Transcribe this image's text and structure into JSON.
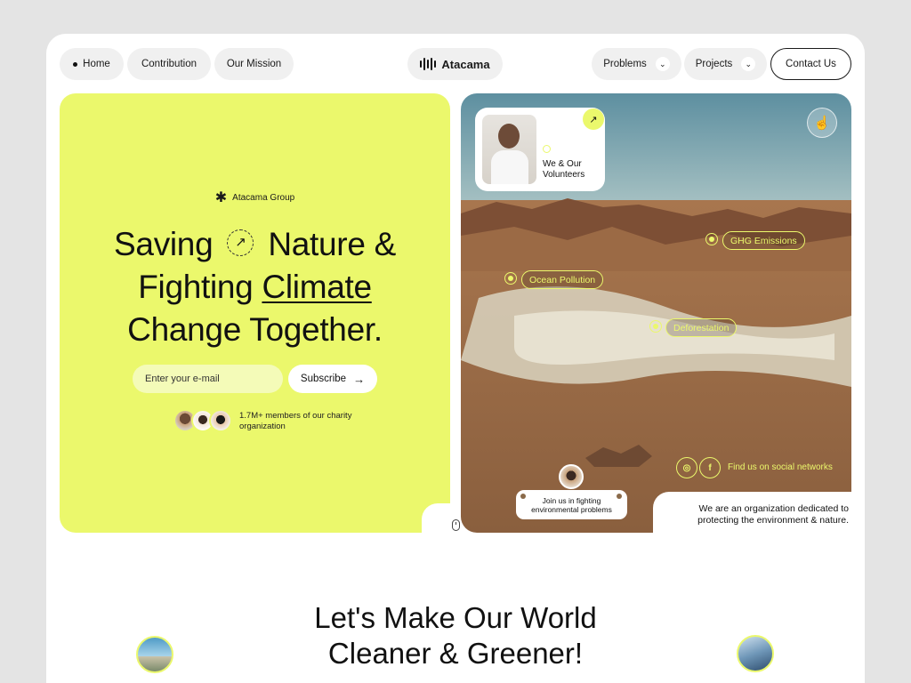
{
  "nav": {
    "left": [
      {
        "label": "Home",
        "active": true
      },
      {
        "label": "Contribution"
      },
      {
        "label": "Our Mission"
      }
    ],
    "brand": "Atacama",
    "right": [
      {
        "label": "Problems"
      },
      {
        "label": "Projects"
      }
    ],
    "contact_label": "Contact Us"
  },
  "hero": {
    "group_label": "Atacama Group",
    "headline_1a": "Saving",
    "headline_1b": "Nature &",
    "headline_2a": "Fighting",
    "headline_2b": "Climate",
    "headline_3": "Change Together.",
    "email_placeholder": "Enter your e-mail",
    "subscribe_label": "Subscribe",
    "members_text": "1.7M+  members of our charity organization"
  },
  "visual": {
    "volunteers_label_1": "We & Our",
    "volunteers_label_2": "Volunteers",
    "tags": [
      "GHG Emissions",
      "Ocean Pollution",
      "Deforestation"
    ],
    "social_text": "Find us on social networks",
    "join_text_1": "Join us in fighting",
    "join_text_2": "environmental problems",
    "org_text_1": "We are an organization dedicated to",
    "org_text_2": "protecting the environment & nature."
  },
  "section2": {
    "title_1": "Let's Make Our World",
    "title_2": "Cleaner & Greener!"
  },
  "colors": {
    "accent": "#ebf86c",
    "page_bg": "#e4e4e4",
    "card_bg": "#ffffff",
    "text": "#111111"
  },
  "icons": [
    "home-dot-icon",
    "chevron-down-icon",
    "asterisk-icon",
    "arrow-up-right-icon",
    "arrow-right-icon",
    "hand-icon",
    "instagram-icon",
    "facebook-icon",
    "mouse-icon"
  ]
}
